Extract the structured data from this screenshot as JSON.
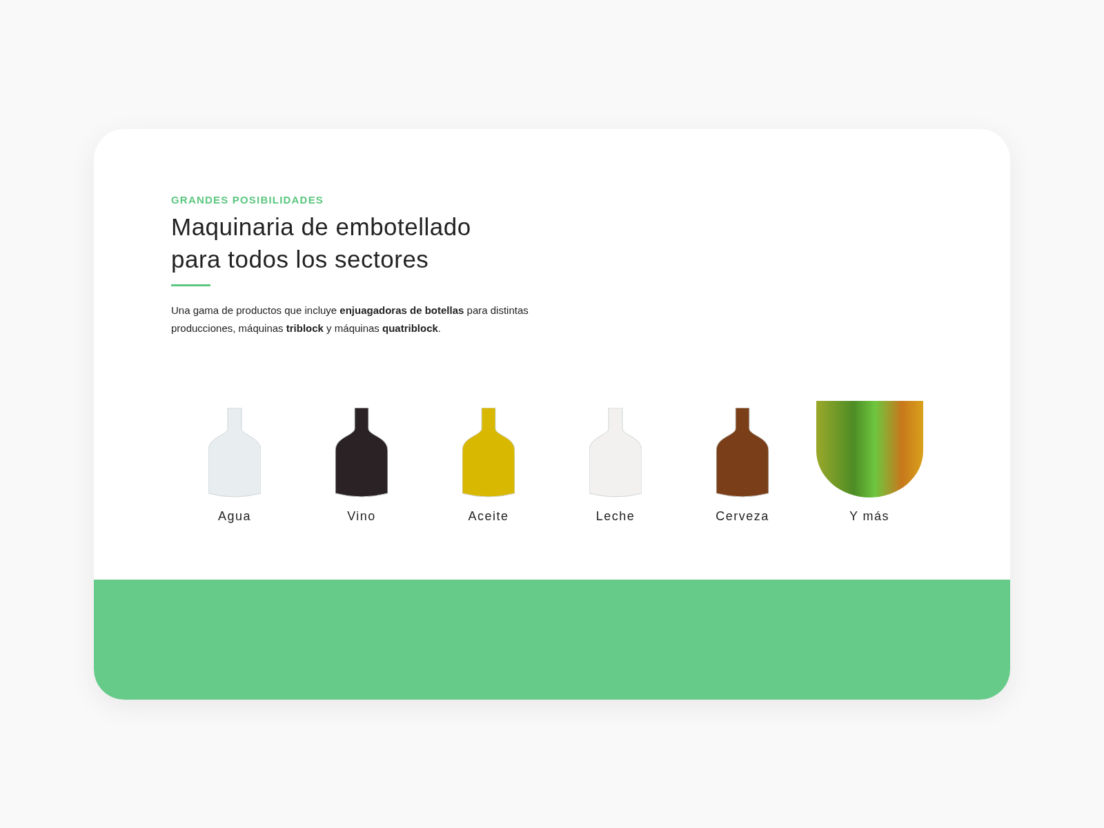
{
  "kicker": "GRANDES POSIBILIDADES",
  "heading_lines": [
    "Maquinaria de embotellado",
    "para todos los sectores"
  ],
  "description": "Una gama de productos que incluye **enjuagadoras de botellas** para distintas producciones, máquinas **triblock** y máquinas **quatriblock**.",
  "products": [
    {
      "label": "Agua",
      "kind": "bottle",
      "color": "#e8eef0"
    },
    {
      "label": "Vino",
      "kind": "bottle",
      "color": "#2a2224"
    },
    {
      "label": "Aceite",
      "kind": "bottle",
      "color": "#d8b800"
    },
    {
      "label": "Leche",
      "kind": "bottle",
      "color": "#f2f1ef"
    },
    {
      "label": "Cerveza",
      "kind": "bottle",
      "color": "#7a3f18"
    },
    {
      "label": "Y más",
      "kind": "photo"
    }
  ]
}
